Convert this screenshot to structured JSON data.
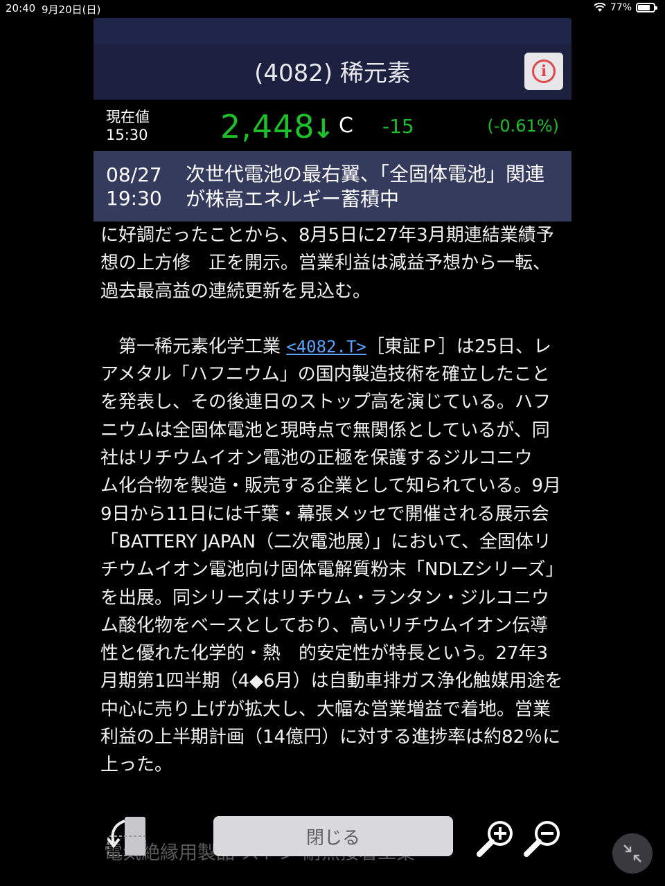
{
  "status_bar": {
    "time": "20:40",
    "date": "9月20日(日)",
    "battery": "77%",
    "battery_level": 0.77
  },
  "header": {
    "title": "(4082) 稀元素",
    "info_icon": "info-icon"
  },
  "quote": {
    "label_line1": "現在値",
    "label_line2": "15:30",
    "price": "2,448",
    "arrow": "↓",
    "flag": "C",
    "change": "-15",
    "change_pct": "(-0.61%)",
    "color_down": "#1fbf2b"
  },
  "news": {
    "date": "08/27",
    "time": "19:30",
    "title": "次世代電池の最右翼、「全固体電池」関連が株高エネルギー蓄積中"
  },
  "article": {
    "para1": "に好調だったことから、8月5日に27年3月期連結業績予想の上方修　正を開示。営業利益は減益予想から一転、過去最高益の連続更新を見込む。",
    "para2_prefix": "　第一稀元素化学工業 ",
    "para2_link": "<4082.T>",
    "para2_body": "［東証Ｐ］は25日、レアメタル「ハフニウム」の国内製造技術を確立したことを発表し、その後連日のストップ高を演じている。ハフニウムは全固体電池と現時点で無関係としているが、同社はリチウムイオン電池の正極を保護するジルコニウ　ム化合物を製造・販売する企業として知られている。9月9日から11日には千葉・幕張メッセで開催される展示会「BATTERY JAPAN（二次電池展）」において、全固体リチウムイオン電池向け固体電解質粉末「NDLZシリーズ」を出展。同シリーズはリチウム・ランタン・ジルコニウム酸化物をベースとしており、高いリチウムイオン伝導性と優れた化学的・熱　的安定性が特長という。27年3月期第1四半期（4◆6月）は自動車排ガス浄化触媒用途を中心に売り上げが拡大し、大幅な営業増益で着地。営業利益の上半期計画（14億円）に対する進捗率は約82％に上った。",
    "faded_line": "電気絶縁用製品 ストン 耐熱接着工業"
  },
  "toolbar": {
    "back_icon": "back-arrow-icon",
    "close_label": "閉じる",
    "zoom_in_icon": "zoom-in-icon",
    "zoom_out_icon": "zoom-out-icon",
    "collapse_icon": "collapse-icon"
  }
}
